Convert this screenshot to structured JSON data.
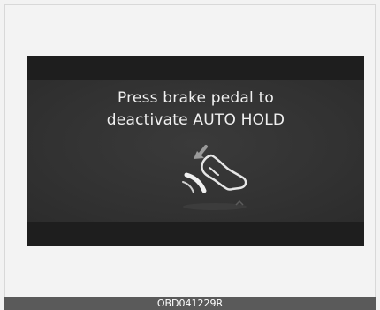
{
  "display": {
    "message_line1": "Press brake pedal to",
    "message_line2": "deactivate AUTO HOLD",
    "icon": "brake-pedal-press-icon"
  },
  "caption": {
    "code": "OBD041229R"
  },
  "colors": {
    "display_background": "#2e2e2e",
    "display_band": "#1e1e1e",
    "message_text": "#f0f0f0",
    "caption_bar": "#5a5a5a"
  }
}
